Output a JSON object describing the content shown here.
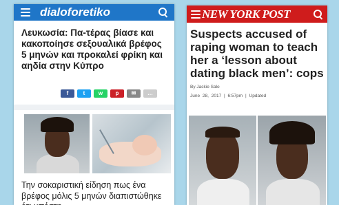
{
  "left_article": {
    "site_name": "dialoforetiko",
    "headline": "Λευκωσία: Πα-τέρας βίασε και κακοποίησε σεξουαλικά βρέφος 5 μηνών και προκαλεί φρίκη και αηδία στην Κύπρο",
    "share_buttons": [
      {
        "icon": "facebook-icon",
        "label": "f",
        "color": "#3b5998"
      },
      {
        "icon": "twitter-icon",
        "label": "t",
        "color": "#1da1f2"
      },
      {
        "icon": "whatsapp-icon",
        "label": "w",
        "color": "#25d366"
      },
      {
        "icon": "pinterest-icon",
        "label": "p",
        "color": "#cb2027"
      },
      {
        "icon": "email-icon",
        "label": "✉",
        "color": "#888888"
      },
      {
        "icon": "comment-icon",
        "label": "…",
        "color": "#bbbbbb"
      }
    ],
    "body_text": "Την σοκαριστική είδηση πως ένα βρέφος μόλις 5 μηνών διαπιστώθηκε ότι υπέστη",
    "colors": {
      "header": "#1f76c8"
    }
  },
  "right_article": {
    "site_name": "NEW YORK POST",
    "headline": "Suspects accused of raping woman to teach her a ‘lesson about dating black men’: cops",
    "byline": "By Jackie Salo",
    "date": "June 28, 2017",
    "time": "6:57pm",
    "updated": "Updated",
    "colors": {
      "header": "#cf1c1c"
    }
  },
  "background_color": "#a9d6ea"
}
